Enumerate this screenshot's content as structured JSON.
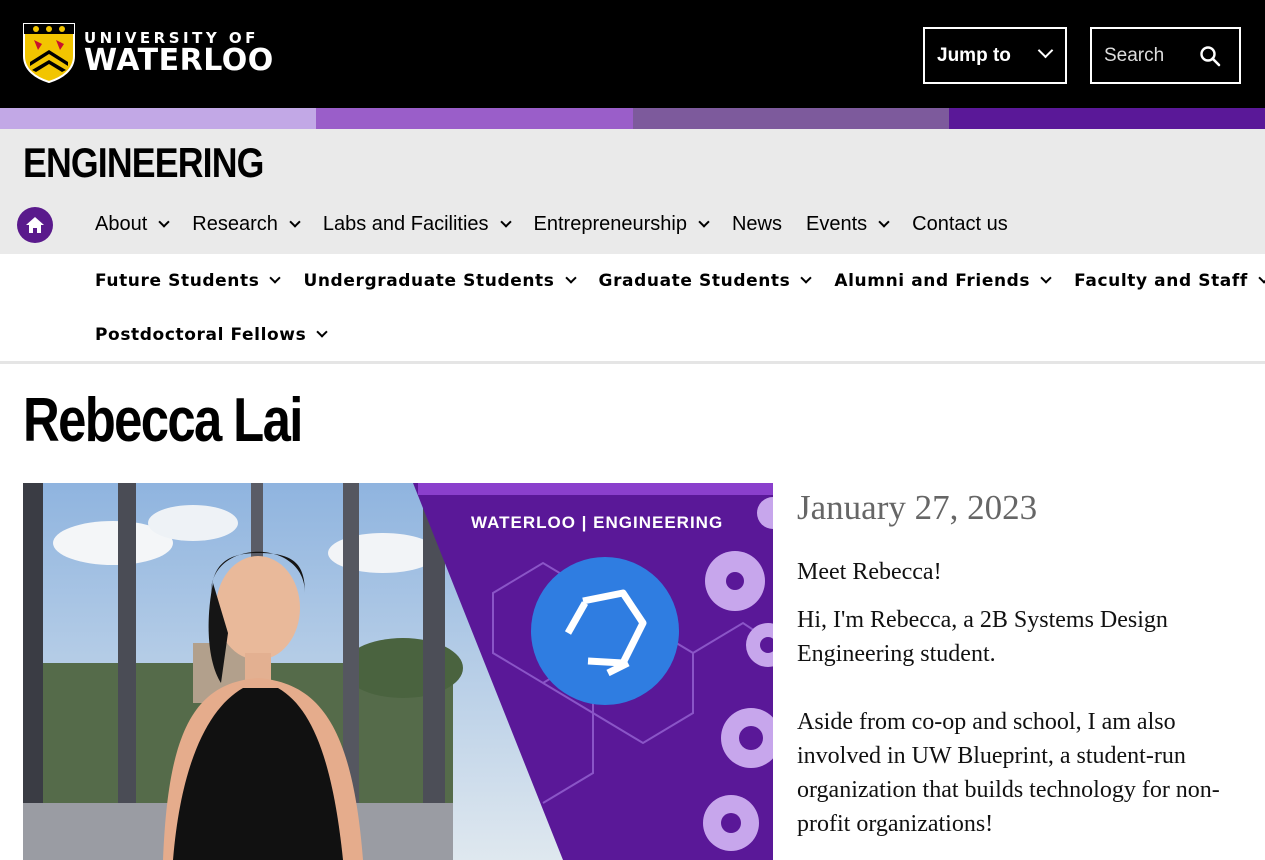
{
  "header": {
    "logo_line1": "UNIVERSITY OF",
    "logo_line2": "WATERLOO",
    "jump_to_label": "Jump to",
    "search_placeholder": "Search"
  },
  "colors": {
    "strip": [
      "#c2a8e6",
      "#9a5ec9",
      "#7d5a9c",
      "#5a1898"
    ],
    "home_button": "#5a1a8c"
  },
  "faculty": {
    "title": "ENGINEERING",
    "nav": [
      {
        "label": "About"
      },
      {
        "label": "Research"
      },
      {
        "label": "Labs and Facilities"
      },
      {
        "label": "Entrepreneurship"
      },
      {
        "label": "News"
      },
      {
        "label": "Events"
      },
      {
        "label": "Contact us"
      }
    ]
  },
  "audience_nav": [
    {
      "label": "Future Students"
    },
    {
      "label": "Undergraduate Students"
    },
    {
      "label": "Graduate Students"
    },
    {
      "label": "Alumni and Friends"
    },
    {
      "label": "Faculty and Staff"
    },
    {
      "label": "Postdoctoral Fellows"
    }
  ],
  "page": {
    "title": "Rebecca Lai",
    "date": "January 27, 2023",
    "hero_banner": "WATERLOO | ENGINEERING",
    "paragraphs": [
      "Meet Rebecca!",
      "Hi, I'm Rebecca, a 2B Systems Design Engineering student.",
      "Aside from co-op and school, I am also involved in UW Blueprint, a student-run organization that builds technology for non-profit organizations!"
    ]
  }
}
